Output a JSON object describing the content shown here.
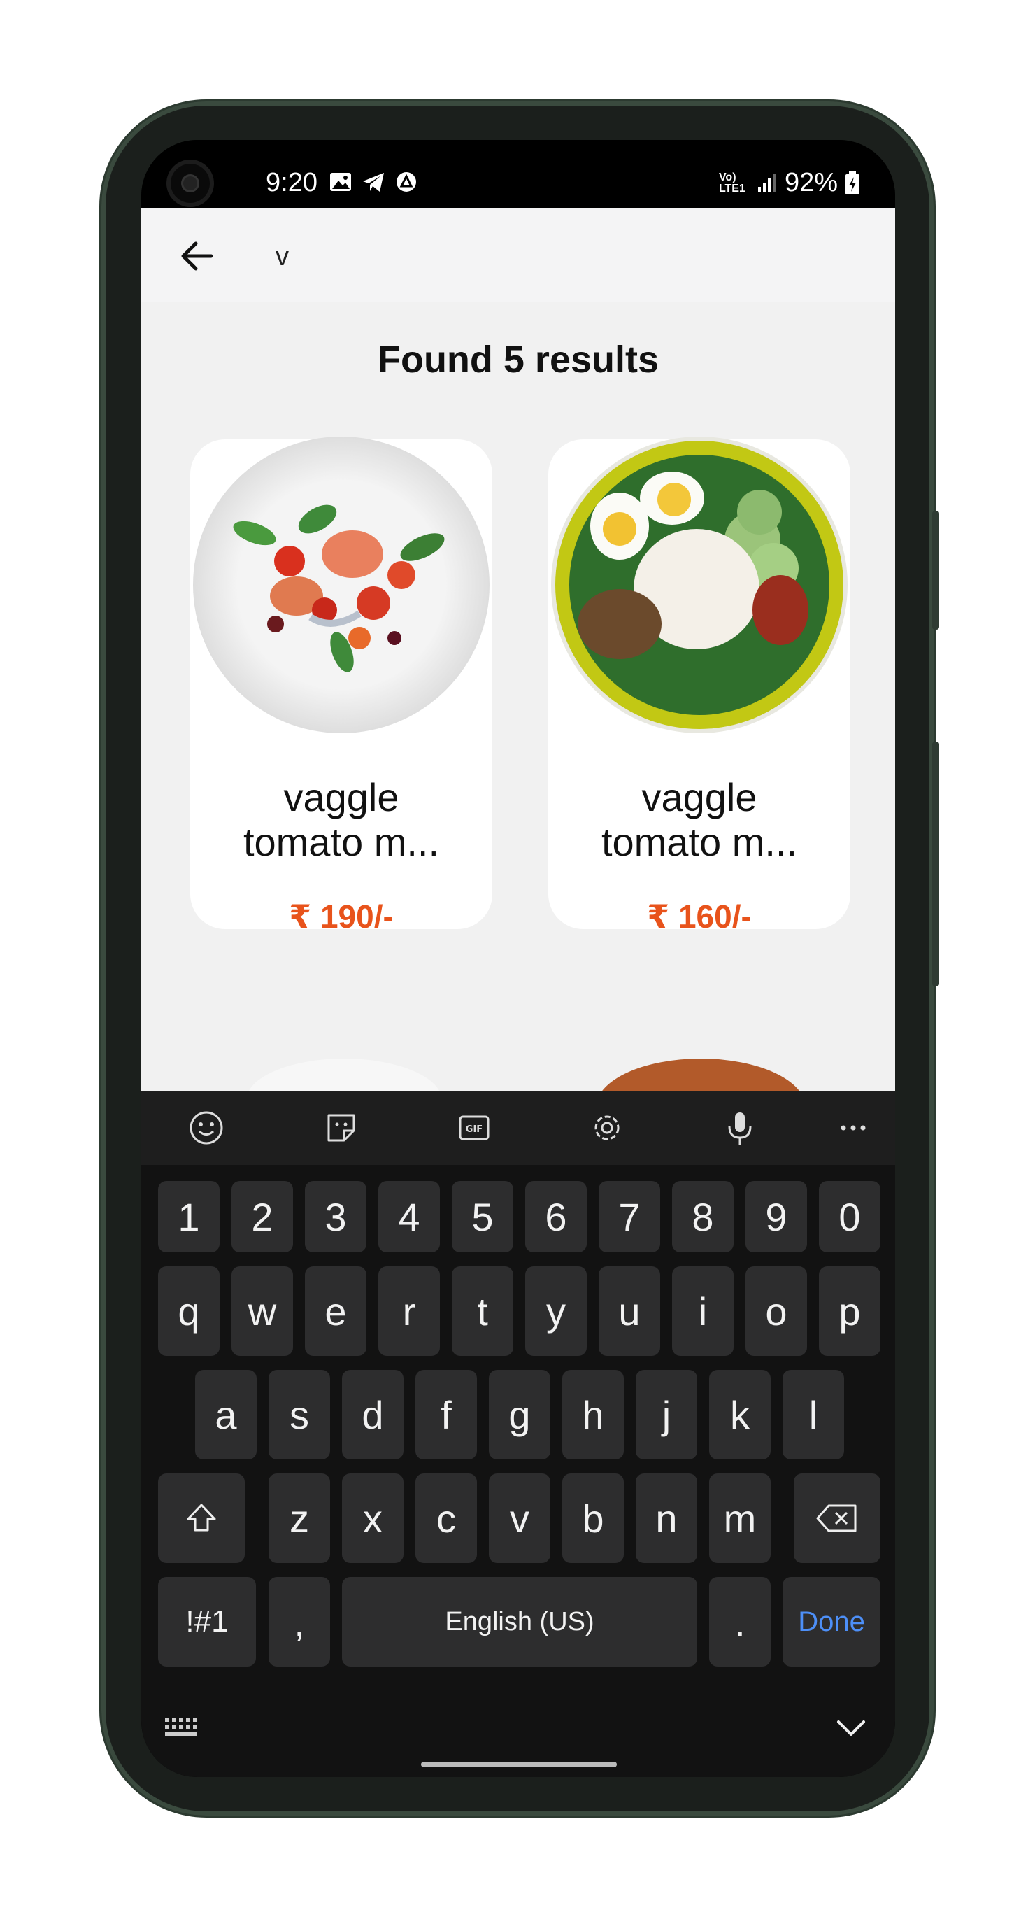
{
  "status_bar": {
    "time": "9:20",
    "battery": "92%",
    "network": "Vo) LTE1"
  },
  "search": {
    "value": "v"
  },
  "results": {
    "title": "Found 5 results"
  },
  "products": [
    {
      "name_line1": "vaggle",
      "name_line2": "tomato m...",
      "price": "₹ 190/-"
    },
    {
      "name_line1": "vaggle",
      "name_line2": "tomato m...",
      "price": "₹ 160/-"
    }
  ],
  "keyboard": {
    "number_row": [
      "1",
      "2",
      "3",
      "4",
      "5",
      "6",
      "7",
      "8",
      "9",
      "0"
    ],
    "row1": [
      "q",
      "w",
      "e",
      "r",
      "t",
      "y",
      "u",
      "i",
      "o",
      "p"
    ],
    "row2": [
      "a",
      "s",
      "d",
      "f",
      "g",
      "h",
      "j",
      "k",
      "l"
    ],
    "row3": [
      "z",
      "x",
      "c",
      "v",
      "b",
      "n",
      "m"
    ],
    "symbols_key": "!#1",
    "comma_key": ",",
    "space_key": "English (US)",
    "period_key": ".",
    "done_key": "Done"
  },
  "colors": {
    "price": "#e8531b",
    "done": "#4d8ff7",
    "key_bg": "#2d2d2e"
  }
}
